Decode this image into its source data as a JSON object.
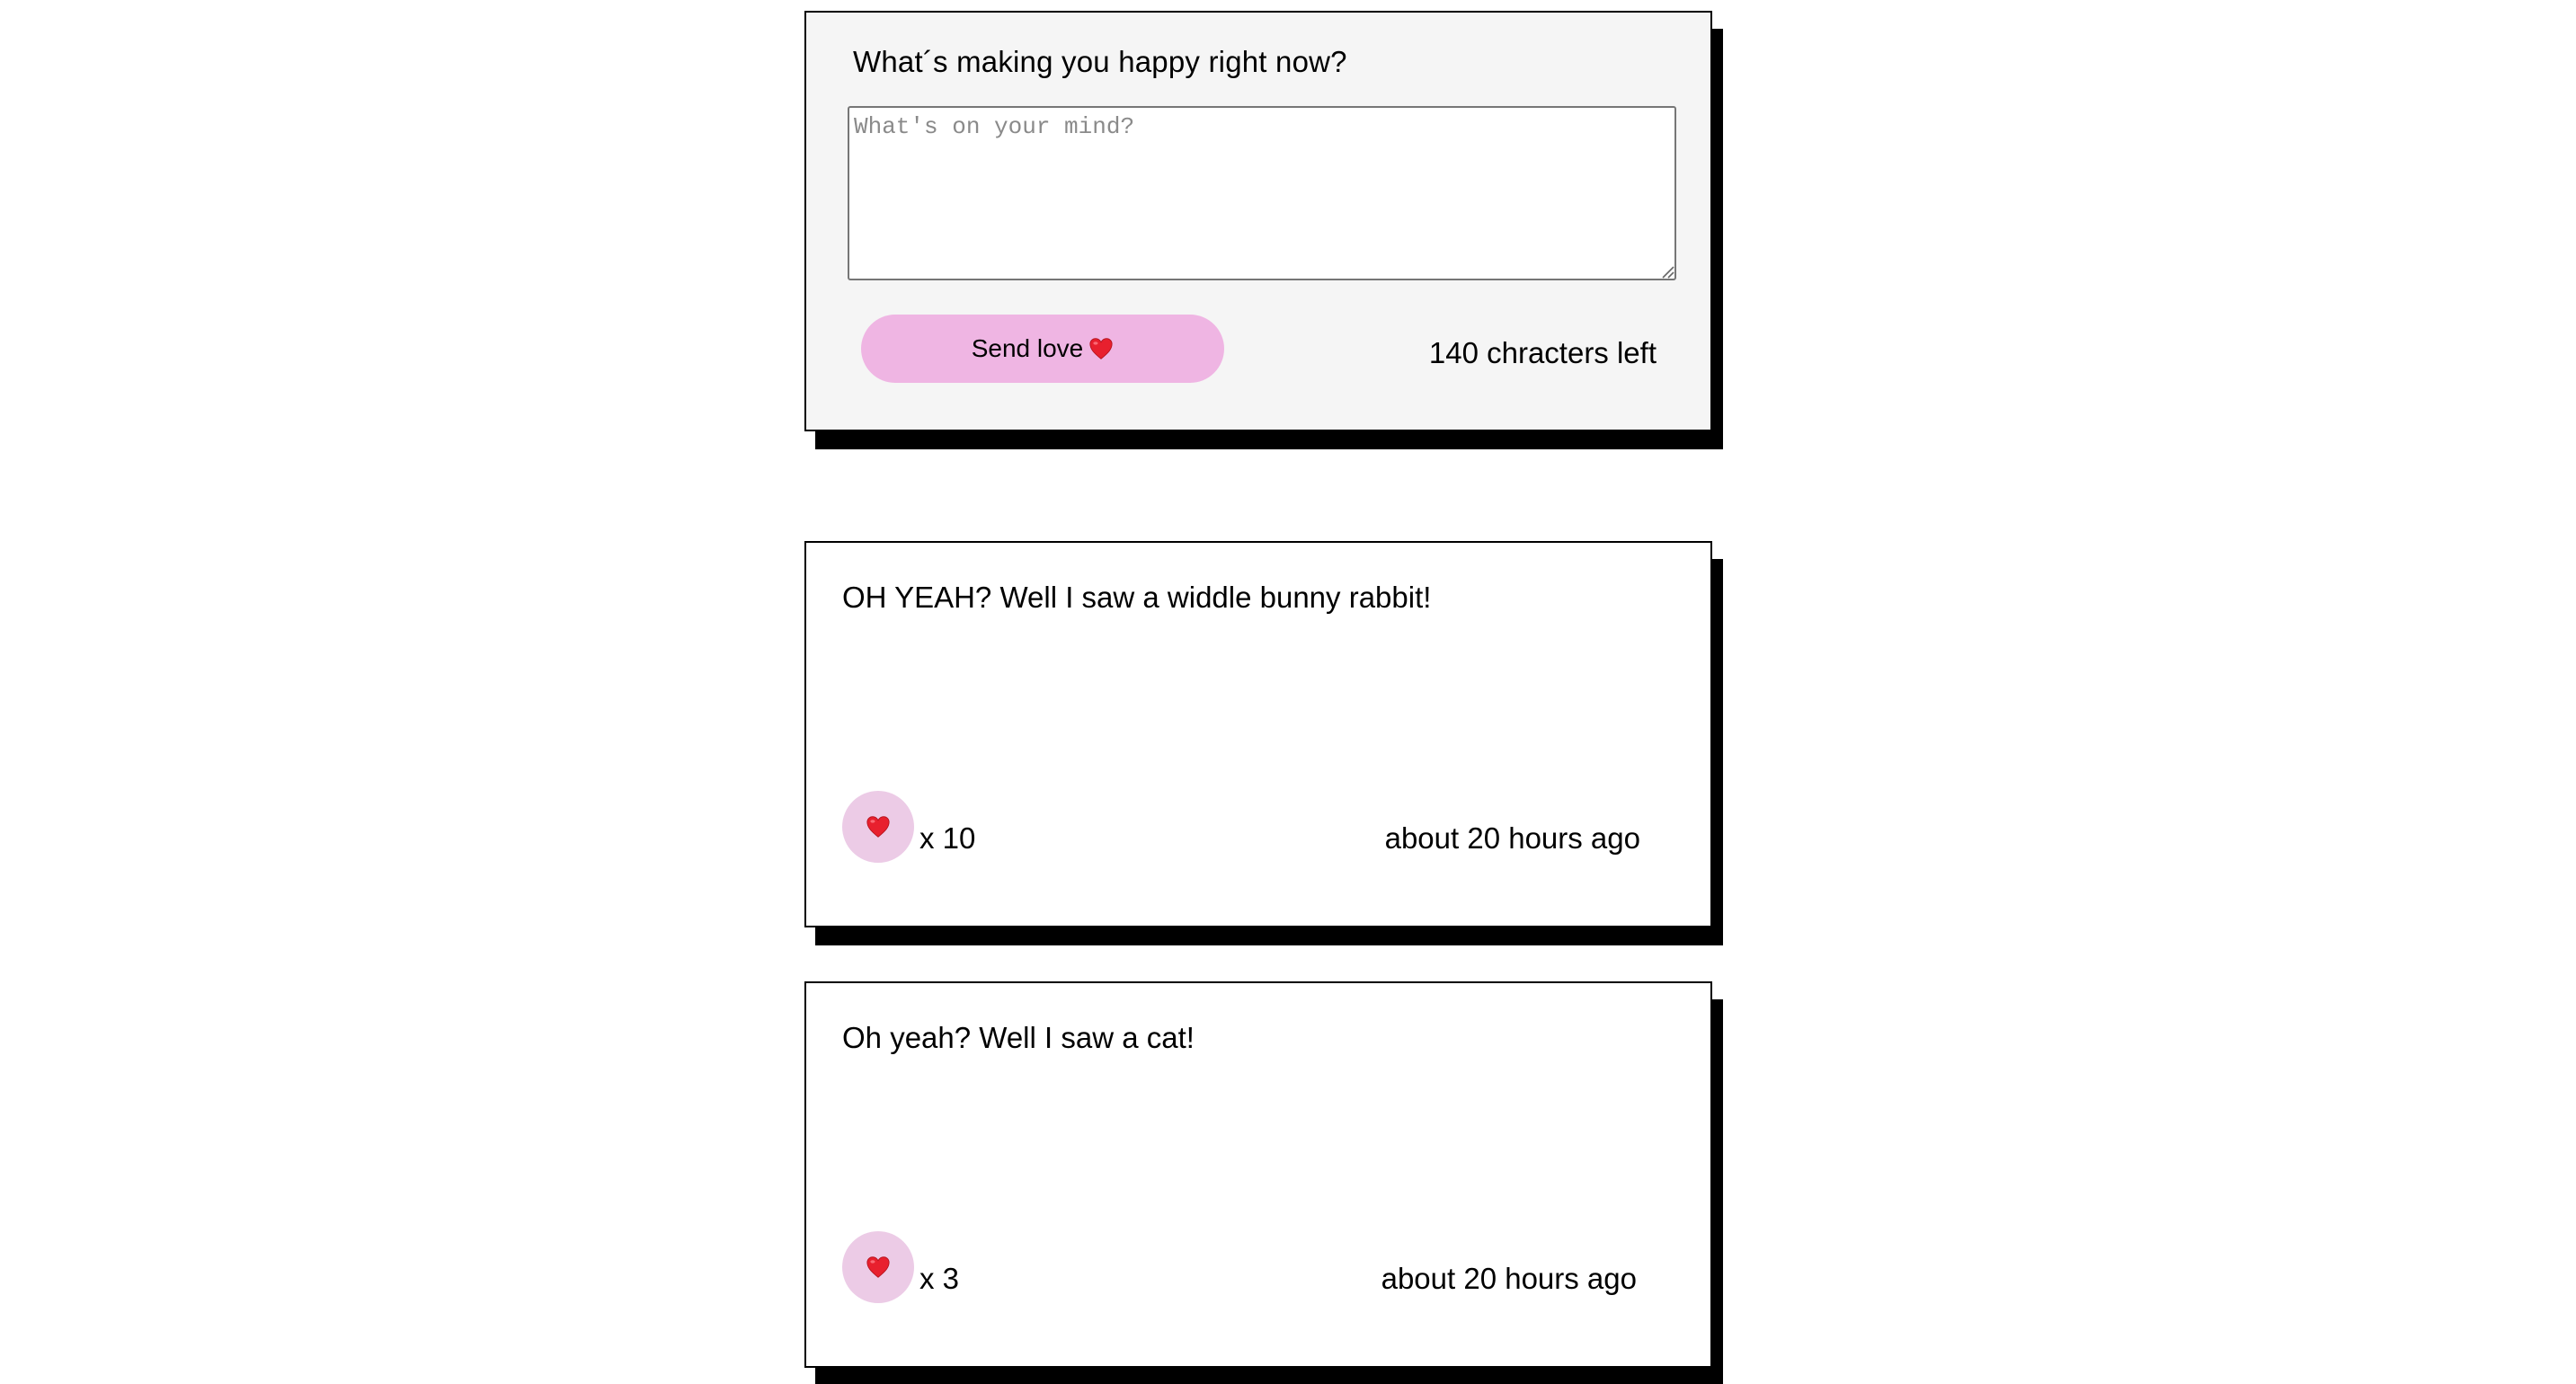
{
  "compose": {
    "heading": "What´s making you happy right now?",
    "placeholder": "What's on your mind?",
    "value": "",
    "send_label": "Send love",
    "send_icon": "heart-icon",
    "char_counter": "140 chracters left"
  },
  "posts": [
    {
      "text": "OH YEAH? Well I saw a widdle bunny rabbit!",
      "like_icon": "heart-icon",
      "likes": "x 10",
      "time": "about 20 hours ago"
    },
    {
      "text": "Oh yeah? Well I saw a cat!",
      "like_icon": "heart-icon",
      "likes": "x 3",
      "time": "about 20 hours ago"
    }
  ],
  "colors": {
    "button_pink": "#efb5e3",
    "like_circle_pink": "#eccbe6",
    "heart_red": "#e8202e",
    "compose_background": "#f5f5f5",
    "shadow": "#000000"
  }
}
